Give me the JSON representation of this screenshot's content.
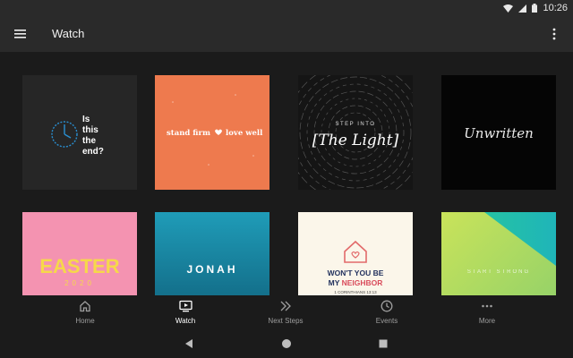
{
  "status_bar": {
    "time": "10:26"
  },
  "app_bar": {
    "title": "Watch"
  },
  "tiles": [
    {
      "name": "is-this-the-end",
      "lines": [
        "Is",
        "this",
        "the",
        "end?"
      ]
    },
    {
      "name": "stand-firm-love-well",
      "text_left": "stand firm",
      "text_right": "love well",
      "bg": "#ee7a4e"
    },
    {
      "name": "step-into-the-light",
      "small": "STEP INTO",
      "big": "[The Light]"
    },
    {
      "name": "unwritten",
      "text": "Unwritten"
    },
    {
      "name": "easter-2020",
      "title": "EASTER",
      "year": "2020",
      "bg": "#f493b1"
    },
    {
      "name": "jonah",
      "title": "JONAH"
    },
    {
      "name": "wont-you-be-my-neighbor",
      "line1": "WON'T YOU BE",
      "line2_a": "MY ",
      "line2_b": "NEIGHBOR",
      "ref": "1 CORINTHIANS 13:13"
    },
    {
      "name": "start-strong",
      "text": "START STRONG"
    }
  ],
  "bottom_nav": {
    "items": [
      {
        "label": "Home",
        "icon": "home-icon"
      },
      {
        "label": "Watch",
        "icon": "play-screen-icon",
        "active": true
      },
      {
        "label": "Next Steps",
        "icon": "double-chevron-icon"
      },
      {
        "label": "Events",
        "icon": "clock-icon"
      },
      {
        "label": "More",
        "icon": "more-dots-icon"
      }
    ]
  },
  "colors": {
    "background": "#1b1b1b",
    "bar": "#2a2a2a",
    "active": "#ffffff",
    "inactive": "#9e9e9e"
  }
}
